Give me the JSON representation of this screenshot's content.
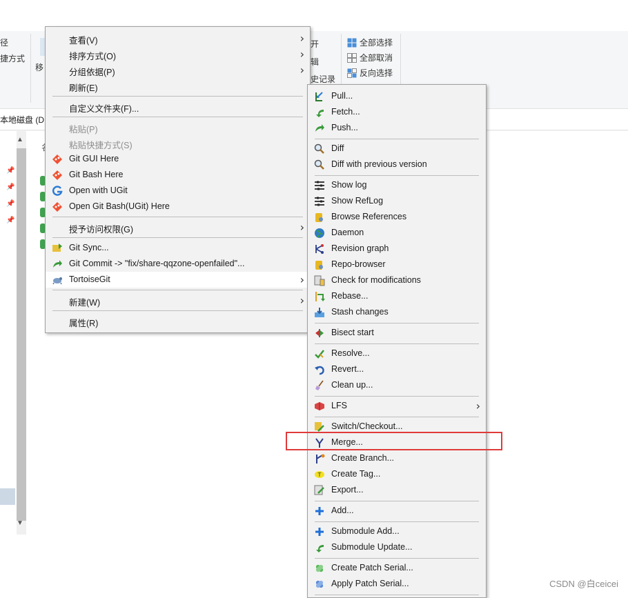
{
  "ribbon": {
    "left_top": "径",
    "left_bottom": "捷方式",
    "move": "移",
    "open": "开",
    "edit": "辑",
    "history": "史记录",
    "select_all": "全部选择",
    "select_none": "全部取消",
    "invert_selection": "反向选择"
  },
  "address": {
    "text": "本地磁盘 (D:"
  },
  "content": {
    "column_header": "名"
  },
  "main_menu": {
    "items": [
      {
        "label": "查看(V)"
      },
      {
        "label": "排序方式(O)"
      },
      {
        "label": "分组依据(P)"
      },
      {
        "label": "刷新(E)"
      },
      {
        "label": "自定义文件夹(F)..."
      },
      {
        "label": "粘贴(P)"
      },
      {
        "label": "粘贴快捷方式(S)"
      },
      {
        "label": "Git GUI Here"
      },
      {
        "label": "Git Bash Here"
      },
      {
        "label": "Open with UGit"
      },
      {
        "label": "Open Git Bash(UGit) Here"
      },
      {
        "label": "授予访问权限(G)"
      },
      {
        "label": "Git Sync..."
      },
      {
        "label": "Git Commit -> \"fix/share-qqzone-openfailed\"..."
      },
      {
        "label": "TortoiseGit"
      },
      {
        "label": "新建(W)"
      },
      {
        "label": "属性(R)"
      }
    ]
  },
  "sub_menu": {
    "items": [
      {
        "label": "Pull..."
      },
      {
        "label": "Fetch..."
      },
      {
        "label": "Push..."
      },
      {
        "label": "Diff"
      },
      {
        "label": "Diff with previous version"
      },
      {
        "label": "Show log"
      },
      {
        "label": "Show RefLog"
      },
      {
        "label": "Browse References"
      },
      {
        "label": "Daemon"
      },
      {
        "label": "Revision graph"
      },
      {
        "label": "Repo-browser"
      },
      {
        "label": "Check for modifications"
      },
      {
        "label": "Rebase..."
      },
      {
        "label": "Stash changes"
      },
      {
        "label": "Bisect start"
      },
      {
        "label": "Resolve..."
      },
      {
        "label": "Revert..."
      },
      {
        "label": "Clean up..."
      },
      {
        "label": "LFS"
      },
      {
        "label": "Switch/Checkout..."
      },
      {
        "label": "Merge..."
      },
      {
        "label": "Create Branch..."
      },
      {
        "label": "Create Tag..."
      },
      {
        "label": "Export..."
      },
      {
        "label": "Add..."
      },
      {
        "label": "Submodule Add..."
      },
      {
        "label": "Submodule Update..."
      },
      {
        "label": "Create Patch Serial..."
      },
      {
        "label": "Apply Patch Serial..."
      }
    ]
  },
  "watermark": "CSDN @白ceicei",
  "colors": {
    "highlight_border": "#e03a3a",
    "menu_bg": "#f2f2f2",
    "accent": "#1e6fd9"
  }
}
